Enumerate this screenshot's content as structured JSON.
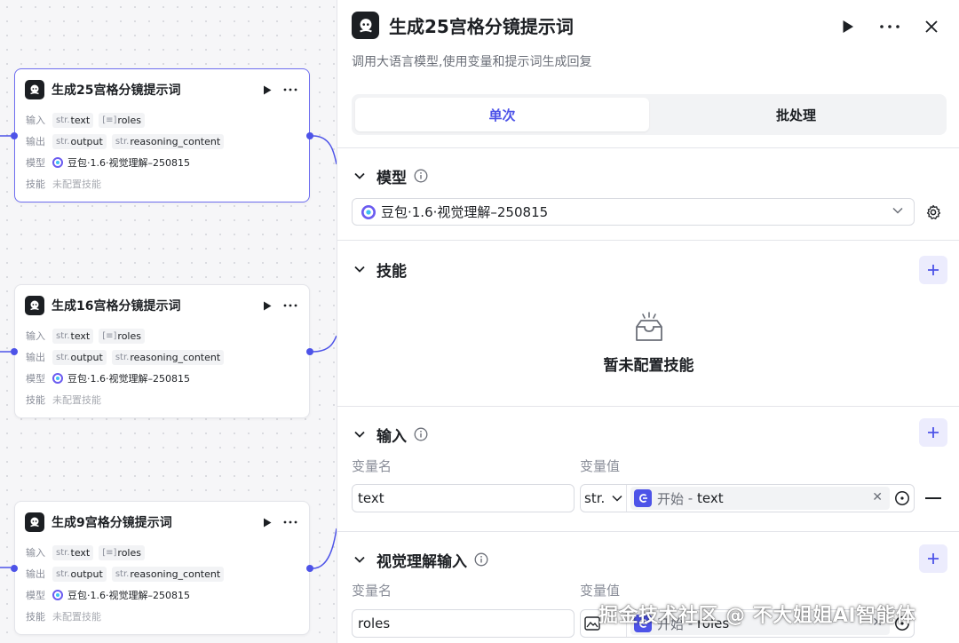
{
  "canvas": {
    "nodes": [
      {
        "title": "生成25宫格分镜提示词",
        "input_label": "输入",
        "inputs": [
          {
            "type": "str.",
            "name": "text"
          },
          {
            "type": "[≡]",
            "name": "roles"
          }
        ],
        "output_label": "输出",
        "outputs": [
          {
            "type": "str.",
            "name": "output"
          },
          {
            "type": "str.",
            "name": "reasoning_content"
          }
        ],
        "model_label": "模型",
        "model": "豆包·1.6·视觉理解–250815",
        "skill_label": "技能",
        "skill": "未配置技能"
      },
      {
        "title": "生成16宫格分镜提示词",
        "input_label": "输入",
        "inputs": [
          {
            "type": "str.",
            "name": "text"
          },
          {
            "type": "[≡]",
            "name": "roles"
          }
        ],
        "output_label": "输出",
        "outputs": [
          {
            "type": "str.",
            "name": "output"
          },
          {
            "type": "str.",
            "name": "reasoning_content"
          }
        ],
        "model_label": "模型",
        "model": "豆包·1.6·视觉理解–250815",
        "skill_label": "技能",
        "skill": "未配置技能"
      },
      {
        "title": "生成9宫格分镜提示词",
        "input_label": "输入",
        "inputs": [
          {
            "type": "str.",
            "name": "text"
          },
          {
            "type": "[≡]",
            "name": "roles"
          }
        ],
        "output_label": "输出",
        "outputs": [
          {
            "type": "str.",
            "name": "output"
          },
          {
            "type": "str.",
            "name": "reasoning_content"
          }
        ],
        "model_label": "模型",
        "model": "豆包·1.6·视觉理解–250815",
        "skill_label": "技能",
        "skill": "未配置技能"
      }
    ]
  },
  "panel": {
    "title": "生成25宫格分镜提示词",
    "description": "调用大语言模型,使用变量和提示词生成回复",
    "tabs": [
      {
        "label": "单次",
        "active": true
      },
      {
        "label": "批处理",
        "active": false
      }
    ],
    "model_section": {
      "title": "模型",
      "selected_model": "豆包·1.6·视觉理解–250815"
    },
    "skills_section": {
      "title": "技能",
      "empty_text": "暂未配置技能"
    },
    "input_section": {
      "title": "输入",
      "name_col": "变量名",
      "value_col": "变量值",
      "rows": [
        {
          "name": "text",
          "type": "str.",
          "source": "开始",
          "sep": " - ",
          "ref": "text"
        }
      ]
    },
    "vision_section": {
      "title": "视觉理解输入",
      "name_col": "变量名",
      "value_col": "变量值",
      "rows": [
        {
          "name": "roles",
          "source": "开始",
          "sep": " - ",
          "ref": "roles"
        }
      ]
    }
  },
  "watermark": "掘金技术社区 @ 不大姐姐AI智能体",
  "colors": {
    "accent": "#4d53e8",
    "accent_soft": "#ececfd",
    "border": "#e4e5ea",
    "muted": "#8a8e99"
  },
  "icons": [
    "bot-logo-icon",
    "play-icon",
    "more-icon",
    "close-icon",
    "chevron-down-icon",
    "info-icon",
    "plus-icon",
    "gear-icon",
    "empty-box-icon",
    "target-icon",
    "image-type-icon",
    "model-logo-icon"
  ]
}
